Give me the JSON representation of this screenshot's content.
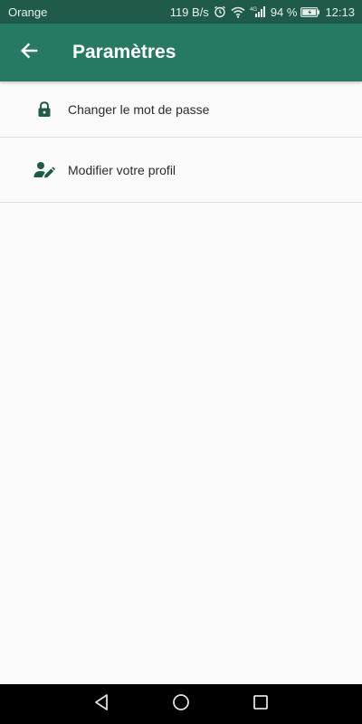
{
  "status_bar": {
    "carrier": "Orange",
    "speed": "119 B/s",
    "network": "4G",
    "battery": "94 %",
    "time": "12:13",
    "icons": [
      "alarm-icon",
      "wifi-icon",
      "signal-icon",
      "battery-icon"
    ]
  },
  "toolbar": {
    "title": "Paramètres",
    "back_icon": "arrow-back-icon"
  },
  "settings": {
    "items": [
      {
        "label": "Changer le mot de passe",
        "icon": "lock-icon"
      },
      {
        "label": "Modifier votre profil",
        "icon": "edit-profile-icon"
      }
    ]
  },
  "nav_bar": {
    "buttons": [
      "back-triangle-icon",
      "home-circle-icon",
      "recents-square-icon"
    ]
  },
  "colors": {
    "status_bar": "#1f5a4a",
    "toolbar": "#267a63",
    "icon_accent": "#1f5a4a",
    "background": "#fafafa"
  }
}
